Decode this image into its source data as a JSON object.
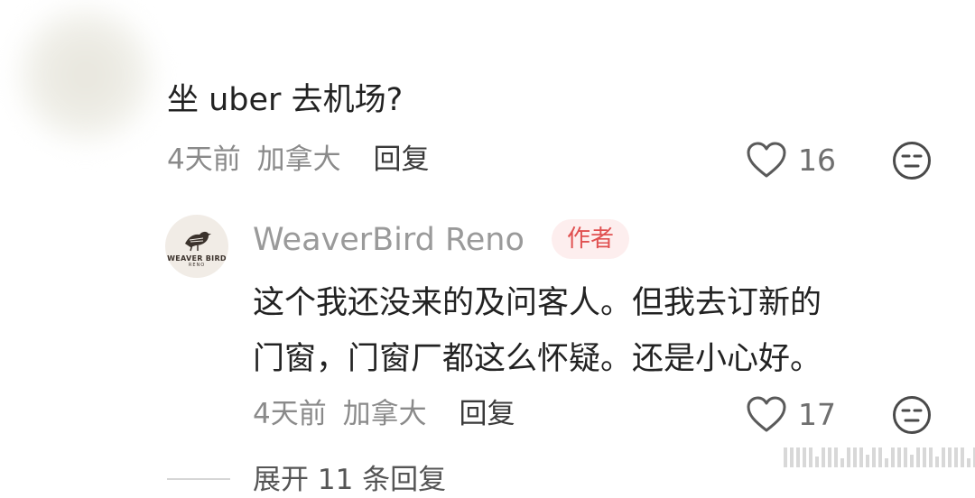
{
  "comment1": {
    "text": "坐 uber 去机场?",
    "time": "4天前",
    "location": "加拿大",
    "reply_label": "回复",
    "likes": "16"
  },
  "comment2": {
    "avatar_text": "WEAVER BIRD",
    "avatar_subtext": "RENO",
    "author": "WeaverBird Reno",
    "author_badge": "作者",
    "lines": [
      "这个我还没来的及问客人。但我去订新的",
      "门窗，门窗厂都这么怀疑。还是小心好。"
    ],
    "time": "4天前",
    "location": "加拿大",
    "reply_label": "回复",
    "likes": "17"
  },
  "expand_replies": "展开 11 条回复",
  "icons": {
    "like": "heart-outline-icon",
    "react": "neutral-face-icon"
  },
  "colors": {
    "badge_bg": "#fdeeee",
    "badge_text": "#e05050",
    "meta_text": "#8a8a8a"
  }
}
